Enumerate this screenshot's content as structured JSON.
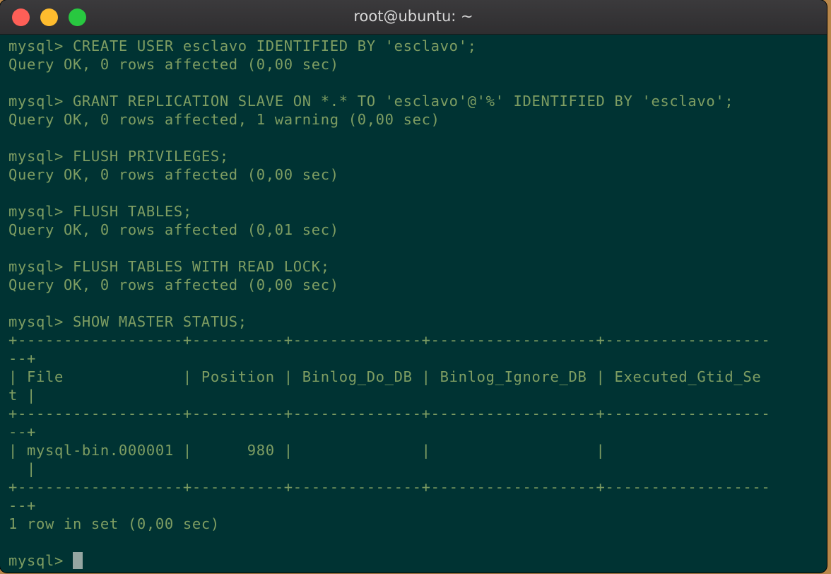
{
  "window": {
    "title": "root@ubuntu: ~",
    "buttons": {
      "close": "close-button",
      "minimize": "minimize-button",
      "zoom": "zoom-button"
    }
  },
  "terminal": {
    "lines": [
      "mysql> CREATE USER esclavo IDENTIFIED BY 'esclavo';",
      "Query OK, 0 rows affected (0,00 sec)",
      "",
      "mysql> GRANT REPLICATION SLAVE ON *.* TO 'esclavo'@'%' IDENTIFIED BY 'esclavo';",
      "Query OK, 0 rows affected, 1 warning (0,00 sec)",
      "",
      "mysql> FLUSH PRIVILEGES;",
      "Query OK, 0 rows affected (0,00 sec)",
      "",
      "mysql> FLUSH TABLES;",
      "Query OK, 0 rows affected (0,01 sec)",
      "",
      "mysql> FLUSH TABLES WITH READ LOCK;",
      "Query OK, 0 rows affected (0,00 sec)",
      "",
      "mysql> SHOW MASTER STATUS;",
      "+------------------+----------+--------------+------------------+------------------",
      "--+",
      "| File             | Position | Binlog_Do_DB | Binlog_Ignore_DB | Executed_Gtid_Se",
      "t |",
      "+------------------+----------+--------------+------------------+------------------",
      "--+",
      "| mysql-bin.000001 |      980 |              |                  |",
      "  |",
      "+------------------+----------+--------------+------------------+------------------",
      "--+",
      "1 row in set (0,00 sec)",
      ""
    ],
    "prompt": "mysql> "
  },
  "colors": {
    "background": "#003333",
    "foreground": "#7e9d62",
    "cursor": "#95a6a2",
    "titlebar": "#353436"
  }
}
